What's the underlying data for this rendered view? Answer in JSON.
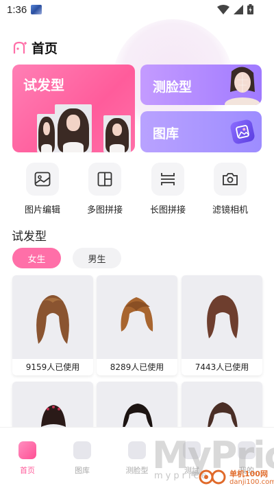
{
  "status_bar": {
    "time": "1:36"
  },
  "header": {
    "title": "首页"
  },
  "feature_cards": {
    "try_hair": "试发型",
    "face_shape": "测脸型",
    "gallery": "图库"
  },
  "tools": [
    {
      "label": "图片编辑",
      "icon": "image-edit-icon"
    },
    {
      "label": "多图拼接",
      "icon": "grid-layout-icon"
    },
    {
      "label": "长图拼接",
      "icon": "long-stitch-icon"
    },
    {
      "label": "滤镜相机",
      "icon": "camera-icon"
    }
  ],
  "section": {
    "title": "试发型",
    "chips": {
      "female": "女生",
      "male": "男生"
    }
  },
  "hairstyles": [
    {
      "usage": "9159人已使用",
      "color": "#7a4a2a"
    },
    {
      "usage": "8289人已使用",
      "color": "#9a5a30"
    },
    {
      "usage": "7443人已使用",
      "color": "#6a3c2c"
    },
    {
      "color": "#2a1a18"
    },
    {
      "color": "#1c1412"
    },
    {
      "color": "#4a2e26"
    }
  ],
  "bottom_nav": [
    {
      "label": "首页",
      "active": true
    },
    {
      "label": "图库"
    },
    {
      "label": "测脸型"
    },
    {
      "label": "测試"
    },
    {
      "label": "我的"
    }
  ],
  "watermark": {
    "text": "MyPrice",
    "sub": "myprice",
    "site_name": "单机100网",
    "site_url": "danji100.com"
  },
  "colors": {
    "accent": "#ff5c9b",
    "purple": "#a07aff"
  }
}
